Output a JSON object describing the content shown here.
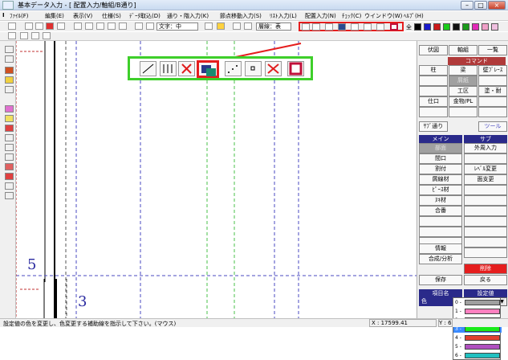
{
  "window": {
    "title": "基本データ入力 - [ 配置入力/軸組/B通り]"
  },
  "menu": [
    "ﾌｧｲﾙ(F)",
    "編集(E)",
    "表示(V)",
    "仕様(S)",
    "ﾃﾞｰﾀ取込(D)",
    "通り・階入力(K)",
    "節点移動入力(S)",
    "ﾘｽﾄ入力(L)",
    "配置入力(N)",
    "ﾁｪｯｸ(C)",
    "ウインドウ(W)",
    "ﾍﾙﾌﾟ(H)"
  ],
  "toolbar": {
    "text_label": "文字：中",
    "layer_label": "層線：表",
    "zen_label": "全"
  },
  "palette": [
    "#000000",
    "#1a1acc",
    "#cc1a1a",
    "#1acc1a",
    "#111111",
    "#1a9a1a",
    "#e22ab8",
    "#f0a0c8",
    "#f0c0e0"
  ],
  "canvas": {
    "label_5": "5",
    "label_3": "3"
  },
  "right": {
    "top_tabs": [
      "伏図",
      "軸組",
      "一覧"
    ],
    "command_header": "コマンド",
    "cmd_row1": [
      "柱",
      "梁",
      "壁ﾌﾞﾚｰｽ"
    ],
    "cmd_row2": [
      "",
      "屑紙",
      ""
    ],
    "cmd_row3": [
      "",
      "工区",
      "塗・耐"
    ],
    "cmd_row4": [
      "仕口",
      "金物/PL",
      ""
    ],
    "sub_via": "ｻﾌﾞ通り",
    "tool": "ツール",
    "main_header": "メイン",
    "sub_header": "サブ",
    "main_items": [
      "部面",
      "間口",
      "割付",
      "屑線材",
      "ﾋﾟｰｽ材",
      "ﾇｷ材",
      "合番",
      "",
      "",
      "",
      "",
      "情報",
      "合成/分析"
    ],
    "sub_items": [
      "外周入力",
      "",
      "ﾚﾍﾞﾙ変更",
      "面支更"
    ],
    "delete": "削除",
    "save": "保存",
    "back": "戻る",
    "prop_name": "項目名",
    "prop_value": "設定値",
    "prop_color": "色",
    "prop_selected": "3 -"
  },
  "dropdown": [
    {
      "n": "0 -",
      "c": "#a0a0a0"
    },
    {
      "n": "1 -",
      "c": "#ff80c0"
    },
    {
      "n": "2 -",
      "c": "#ffff00"
    },
    {
      "n": "3 -",
      "c": "#1aeb1a"
    },
    {
      "n": "4 -",
      "c": "#e04030"
    },
    {
      "n": "5 -",
      "c": "#b050c0"
    },
    {
      "n": "6 -",
      "c": "#20c0c0"
    }
  ],
  "status": {
    "message": "設定値の色を変更し、色変更する補助線を指示して下さい。(マウス)",
    "x": "X : 17599.41",
    "y": "Y : 6000.0"
  }
}
